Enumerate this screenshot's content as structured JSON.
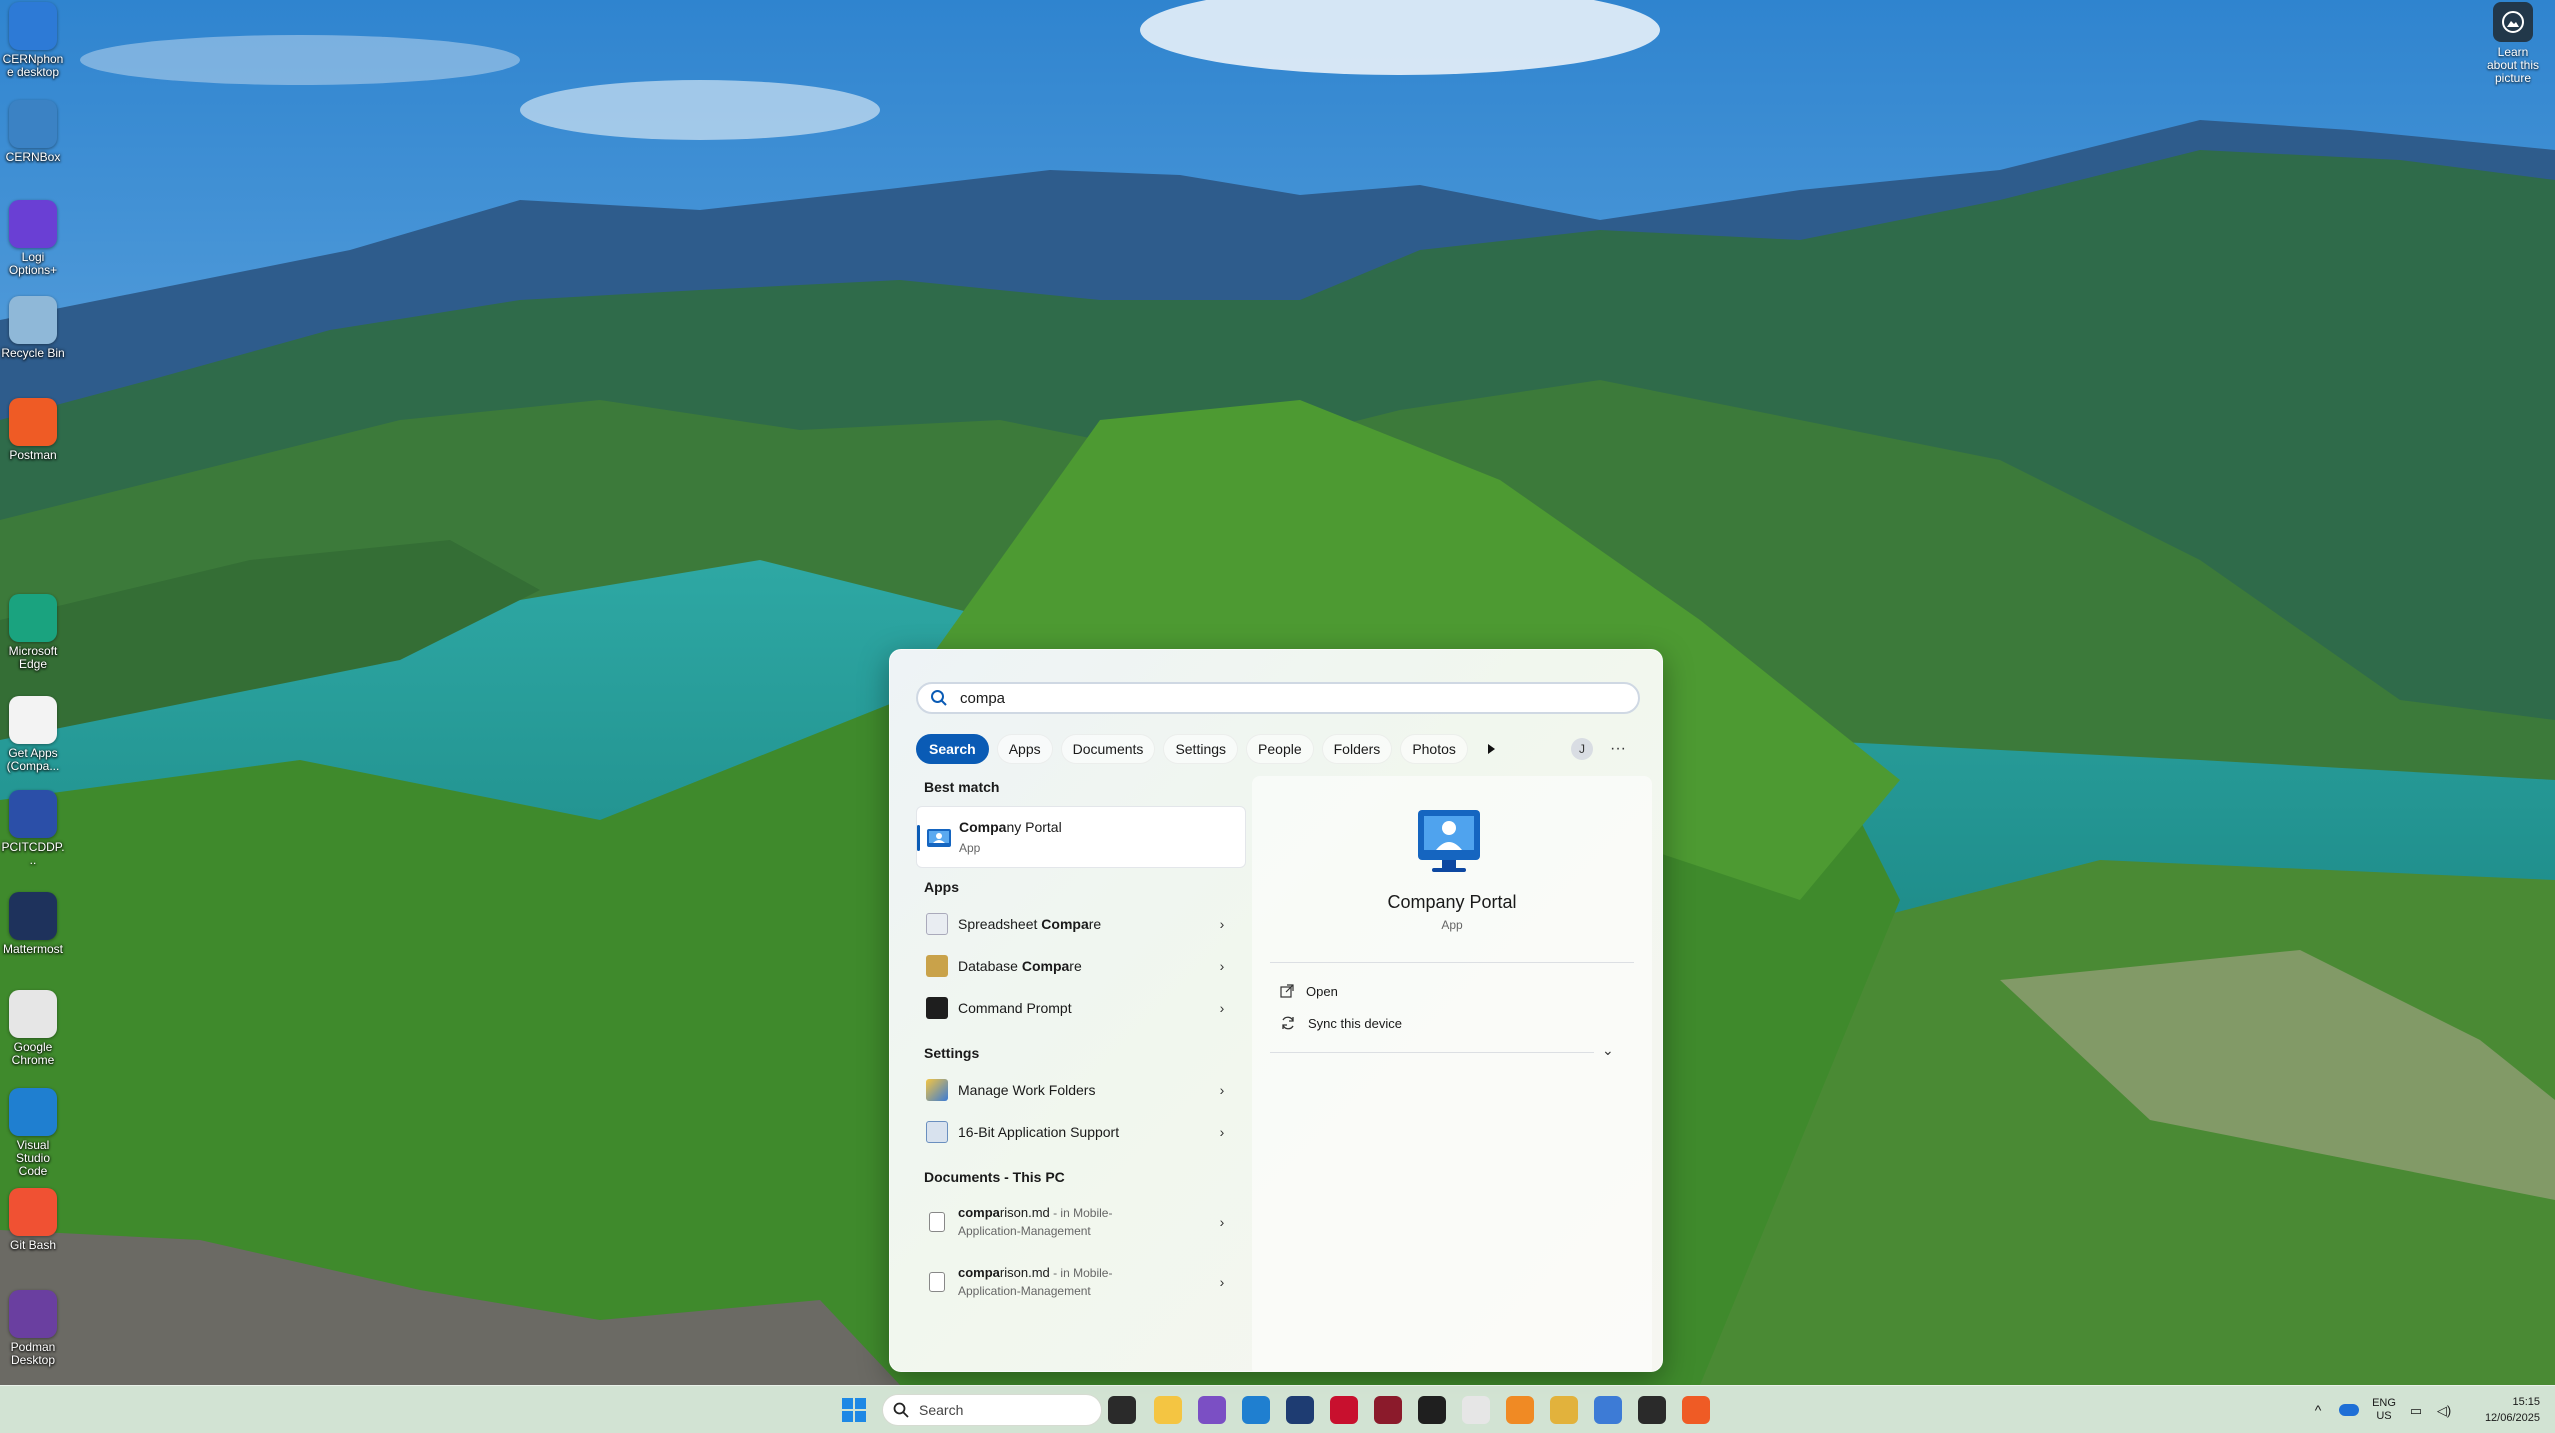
{
  "desktop": {
    "icons": [
      {
        "label": "CERNphone desktop",
        "icon": "cernphone-icon",
        "color": "#2d7ad6"
      },
      {
        "label": "CERNBox",
        "icon": "cernbox-icon",
        "color": "#3b82c4"
      },
      {
        "label": "Logi Options+",
        "icon": "logi-options-icon",
        "color": "#6a3fd4"
      },
      {
        "label": "Recycle Bin",
        "icon": "recycle-bin-icon",
        "color": "#8fb8d8"
      },
      {
        "label": "Postman",
        "icon": "postman-icon",
        "color": "#ef5b25"
      },
      {
        "label": "Microsoft Edge",
        "icon": "edge-icon",
        "color": "#1aa37f"
      },
      {
        "label": "Get Apps (Compa...",
        "icon": "document-icon",
        "color": "#f3f3f3"
      },
      {
        "label": "PCITCDDP...",
        "icon": "remote-desktop-icon",
        "color": "#2b4fa8"
      },
      {
        "label": "Mattermost",
        "icon": "mattermost-icon",
        "color": "#1e325c"
      },
      {
        "label": "Google Chrome",
        "icon": "chrome-icon",
        "color": "#e6e6e6"
      },
      {
        "label": "Visual Studio Code",
        "icon": "vscode-icon",
        "color": "#1f7fd0"
      },
      {
        "label": "Git Bash",
        "icon": "git-bash-icon",
        "color": "#f05133"
      },
      {
        "label": "Podman Desktop",
        "icon": "podman-icon",
        "color": "#6a3fa0"
      }
    ],
    "learn_label": "Learn about this picture"
  },
  "search_panel": {
    "query": "compa",
    "filters": [
      "Search",
      "Apps",
      "Documents",
      "Settings",
      "People",
      "Folders",
      "Photos"
    ],
    "active_filter": "Search",
    "avatar_initial": "J",
    "more_label": "···",
    "best_match_header": "Best match",
    "best_match": {
      "title_bold": "Compa",
      "title_rest": "ny Portal",
      "subtitle": "App"
    },
    "apps_header": "Apps",
    "apps": [
      {
        "pre": "Spreadsheet ",
        "bold": "Compa",
        "post": "re",
        "icon": "spreadsheet-compare-icon"
      },
      {
        "pre": "Database ",
        "bold": "Compa",
        "post": "re",
        "icon": "database-compare-icon"
      },
      {
        "pre": "Command Prompt",
        "bold": "",
        "post": "",
        "icon": "command-prompt-icon"
      }
    ],
    "settings_header": "Settings",
    "settings": [
      {
        "label": "Manage Work Folders",
        "icon": "work-folders-icon"
      },
      {
        "label": "16-Bit Application Support",
        "icon": "app-support-icon"
      }
    ],
    "documents_header": "Documents - This PC",
    "documents": [
      {
        "bold": "compa",
        "rest": "rison.md",
        "location": " - in Mobile-",
        "location2": "Application-Management"
      },
      {
        "bold": "compa",
        "rest": "rison.md",
        "location": " - in Mobile-",
        "location2": "Application-Management"
      }
    ],
    "preview": {
      "title": "Company Portal",
      "subtitle": "App",
      "actions": [
        "Open",
        "Sync this device"
      ]
    }
  },
  "taskbar": {
    "search_placeholder": "Search",
    "language": "ENG",
    "region": "US",
    "time": "15:15",
    "date": "12/06/2025",
    "apps": [
      {
        "icon": "task-view-icon",
        "color": "#2a2a2a"
      },
      {
        "icon": "file-explorer-icon",
        "color": "#f4c542"
      },
      {
        "icon": "visual-studio-icon",
        "color": "#7b4fc4"
      },
      {
        "icon": "vscode-icon",
        "color": "#1f7fd0"
      },
      {
        "icon": "app-red-badge-icon",
        "color": "#1e3c72"
      },
      {
        "icon": "app-red-icon",
        "color": "#c8102e"
      },
      {
        "icon": "app-dark-red-icon",
        "color": "#8b1a2b"
      },
      {
        "icon": "clion-icon",
        "color": "#1f1f1f"
      },
      {
        "icon": "chrome-icon",
        "color": "#e6e6e6"
      },
      {
        "icon": "orange-app-icon",
        "color": "#f08a24"
      },
      {
        "icon": "snipping-tool-icon",
        "color": "#e2b23c"
      },
      {
        "icon": "chrome-profile-icon",
        "color": "#3d7bd6"
      },
      {
        "icon": "terminal-icon",
        "color": "#2a2a2a"
      },
      {
        "icon": "postman-icon",
        "color": "#ef5b25"
      }
    ]
  }
}
